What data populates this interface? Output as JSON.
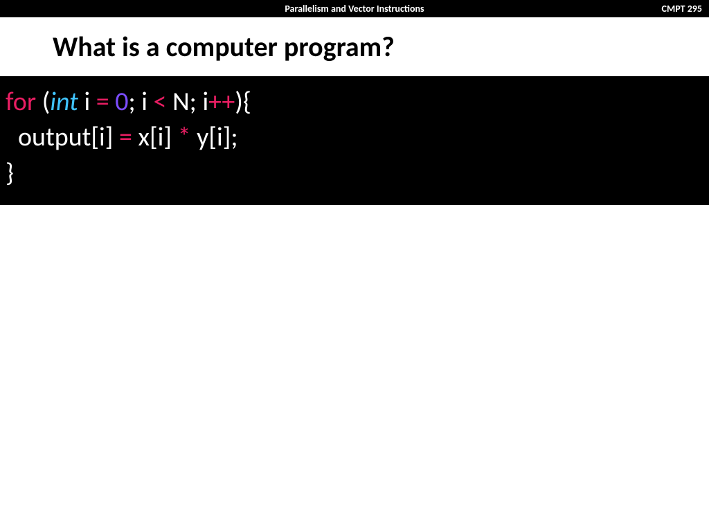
{
  "header": {
    "title": "Parallelism and Vector Instructions",
    "course": "CMPT 295"
  },
  "slide": {
    "title": "What is a computer program?"
  },
  "code": {
    "line1": {
      "for": "for",
      "space1": " ",
      "paren_open": "(",
      "int": "int",
      "space2": " ",
      "i1": "i ",
      "eq": "=",
      "space3": " ",
      "zero": "0",
      "semi1": "; i ",
      "lt": "<",
      "rest1": " N; i",
      "inc": "++",
      "end1": "){"
    },
    "line2": {
      "lhs": "output[i] ",
      "eq": "=",
      "mid": " x[i] ",
      "star": "*",
      "rhs": " y[i];"
    },
    "line3": {
      "brace": "}"
    }
  }
}
